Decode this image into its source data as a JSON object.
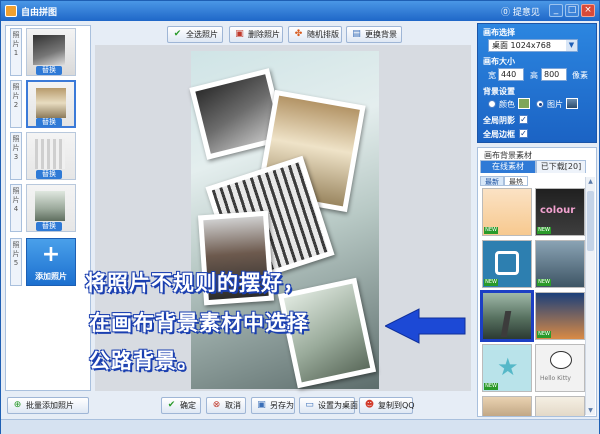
{
  "window": {
    "title": "自由拼图",
    "feedback": "提意见",
    "controls": [
      "_",
      "□",
      "×"
    ]
  },
  "toolbar": {
    "select_all": "全选照片",
    "delete": "删除照片",
    "random": "随机排版",
    "change_bg": "更换背景"
  },
  "thumbs": {
    "items": [
      {
        "tab": "照片1",
        "swap": "替换"
      },
      {
        "tab": "照片2",
        "swap": "替换"
      },
      {
        "tab": "照片3",
        "swap": "替换"
      },
      {
        "tab": "照片4",
        "swap": "替换"
      },
      {
        "tab": "照片5"
      }
    ],
    "add_label": "添加照片",
    "add_plus": "+",
    "batch_add": "批量添加照片"
  },
  "bottom": {
    "ok": "确定",
    "cancel": "取消",
    "save_as": "另存为",
    "set_desktop": "设置为桌面",
    "copy_qq": "复制到QQ"
  },
  "overlay": {
    "line1": "将照片不规则的摆好，",
    "line2": "在画布背景素材中选择",
    "line3": "公路背景。"
  },
  "panel": {
    "canvas_select": "画布选择",
    "canvas_value": "桌面  1024x768",
    "canvas_size": "画布大小",
    "width_label": "宽",
    "width": "440",
    "height_label": "高",
    "height": "800",
    "unit": "像素",
    "bg_setting": "背景设置",
    "color_label": "颜色",
    "picture_label": "图片",
    "global_shadow": "全局阴影",
    "global_border": "全局边框",
    "color_swatch": "#7fa65a"
  },
  "material": {
    "header": "画布背景素材",
    "tab_online": "在线素材",
    "tab_downloaded": "已下载[20]",
    "sub_latest": "最新",
    "sub_hot": "最热",
    "new_badge": "NEW"
  },
  "colors": {
    "accent": "#2f7ad6",
    "title_bar": "#1f67c8",
    "arrow": "#1c49d6"
  }
}
